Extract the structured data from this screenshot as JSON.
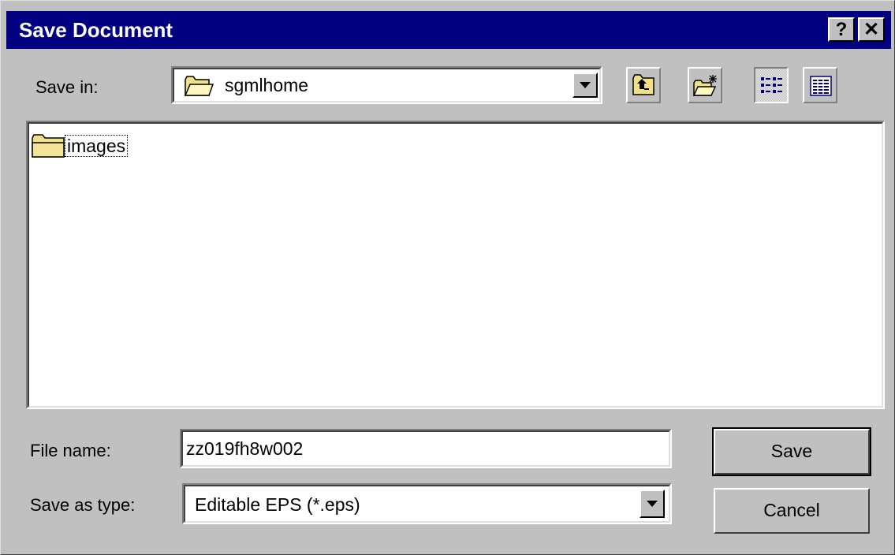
{
  "window": {
    "title": "Save Document",
    "help_glyph": "?",
    "close_glyph": "✕"
  },
  "save_in": {
    "label": "Save in:",
    "value": "sgmlhome"
  },
  "toolbar": {
    "icons": [
      "up-one-level-icon",
      "create-new-folder-icon",
      "list-view-icon",
      "details-view-icon"
    ],
    "pressed": "list-view-icon"
  },
  "file_list": {
    "items": [
      {
        "type": "folder",
        "name": "images",
        "focused": true
      }
    ]
  },
  "file_name": {
    "label": "File name:",
    "value": "zz019fh8w002"
  },
  "save_as_type": {
    "label": "Save as type:",
    "value": "Editable EPS (*.eps)"
  },
  "buttons": {
    "save": "Save",
    "cancel": "Cancel"
  }
}
